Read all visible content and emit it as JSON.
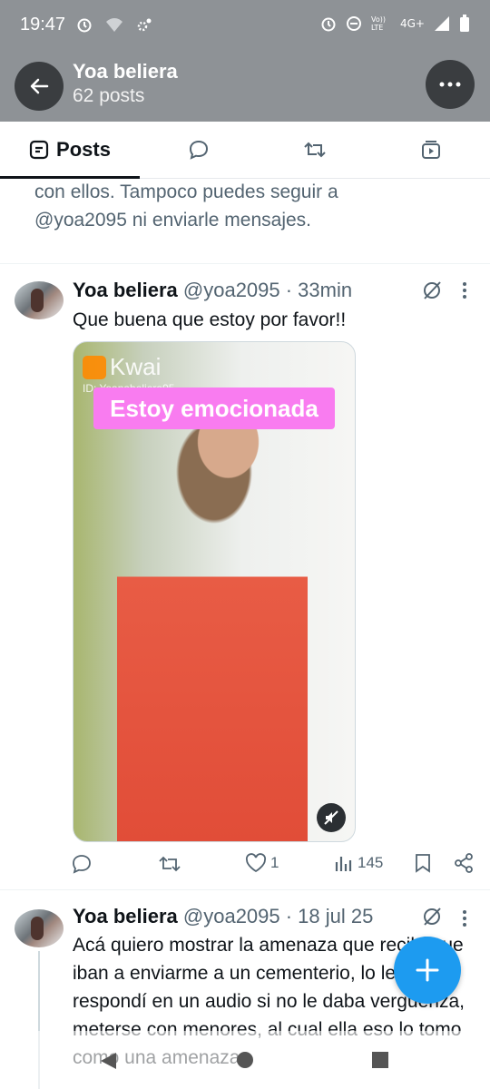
{
  "status_bar": {
    "time": "19:47",
    "network": "4G+",
    "volte": "Vo)) LTE"
  },
  "header": {
    "title": "Yoa beliera",
    "subtitle": "62 posts"
  },
  "tabs": {
    "posts_label": "Posts"
  },
  "notice": {
    "line1": "con ellos. Tampoco puedes seguir a",
    "line2": "@yoa2095 ni enviarle mensajes."
  },
  "post1": {
    "name": "Yoa beliera",
    "handle": "@yoa2095 · 33min",
    "text": "Que buena que estoy por favor!!",
    "media": {
      "brand": "Kwai",
      "id_text": "ID: Yoanabeliera95",
      "caption": "Estoy emocionada"
    },
    "stats": {
      "likes": "1",
      "views": "145"
    }
  },
  "post2": {
    "name": "Yoa beliera",
    "handle": "@yoa2095 · 18 jul 25",
    "text": "Acá quiero mostrar la amenaza que recibí que iban a enviarme a un cementerio, lo le respondí en un audio si no le daba vergüenza, meterse con menores, al cual ella eso lo tomo como una amenaza"
  },
  "colors": {
    "accent": "#1d9bf0",
    "header_bg": "#8e9296",
    "text": "#0f1419",
    "muted": "#536471"
  }
}
